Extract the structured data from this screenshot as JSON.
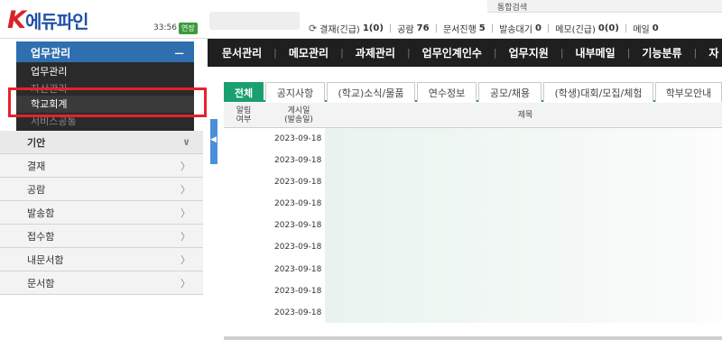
{
  "header": {
    "logo_k": "K",
    "logo_text": "에듀파인",
    "time": "33:56",
    "extend_badge": "연장",
    "search_label": "통합검색",
    "status": [
      {
        "label": "결재(긴급)",
        "count": "1(0)"
      },
      {
        "label": "공람",
        "count": "76"
      },
      {
        "label": "문서진행",
        "count": "5"
      },
      {
        "label": "발송대기",
        "count": "0"
      },
      {
        "label": "메모(긴급)",
        "count": "0(0)"
      },
      {
        "label": "메일",
        "count": "0"
      }
    ]
  },
  "left_menu": {
    "title": "업무관리",
    "collapse_symbol": "−",
    "dropdown": [
      {
        "label": "업무관리"
      },
      {
        "label": "자산관리"
      },
      {
        "label": "학교회계"
      },
      {
        "label": "서비스공통"
      }
    ],
    "items": [
      {
        "label": "기안",
        "chevron": "∨"
      },
      {
        "label": "결재",
        "chevron": "〉"
      },
      {
        "label": "공람",
        "chevron": "〉"
      },
      {
        "label": "발송함",
        "chevron": "〉"
      },
      {
        "label": "접수함",
        "chevron": "〉"
      },
      {
        "label": "내문서함",
        "chevron": "〉"
      },
      {
        "label": "문서함",
        "chevron": "〉"
      }
    ]
  },
  "main_nav": [
    "문서관리",
    "메모관리",
    "과제관리",
    "업무인계인수",
    "업무지원",
    "내부메일",
    "기능분류",
    "자"
  ],
  "tabs": [
    {
      "label": "전체",
      "active": true
    },
    {
      "label": "공지사항"
    },
    {
      "label": "(학교)소식/물품"
    },
    {
      "label": "연수정보"
    },
    {
      "label": "공모/채용"
    },
    {
      "label": "(학생)대회/모집/체험"
    },
    {
      "label": "학부모안내"
    }
  ],
  "table": {
    "col_alarm": "알림\n여부",
    "col_date": "게시일\n(발송일)",
    "col_title": "제목",
    "rows": [
      {
        "date": "2023-09-18"
      },
      {
        "date": "2023-09-18"
      },
      {
        "date": "2023-09-18"
      },
      {
        "date": "2023-09-18"
      },
      {
        "date": "2023-09-18"
      },
      {
        "date": "2023-09-18"
      },
      {
        "date": "2023-09-18"
      },
      {
        "date": "2023-09-18"
      },
      {
        "date": "2023-09-18"
      }
    ]
  }
}
